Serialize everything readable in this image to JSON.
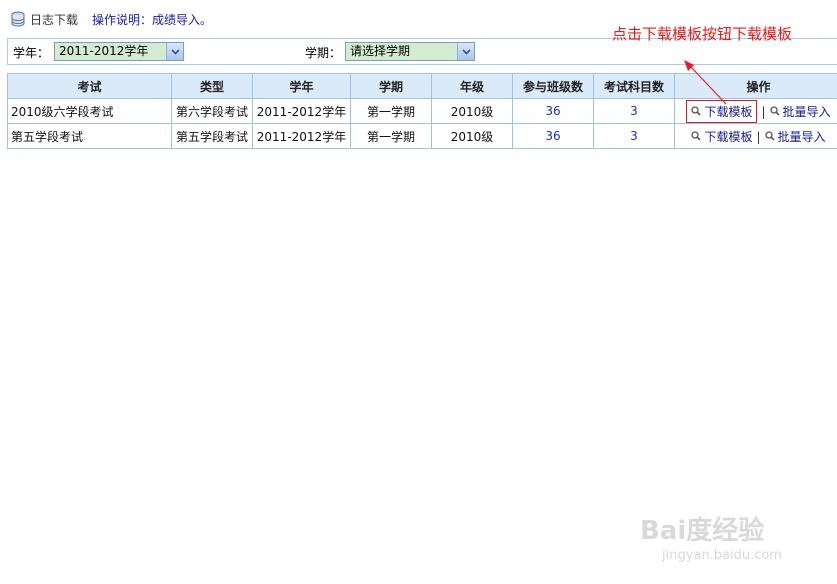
{
  "header": {
    "log_link": "日志下载",
    "instruction": "操作说明：成绩导入。"
  },
  "filters": {
    "year_label": "学年：",
    "year_value": "2011-2012学年",
    "term_label": "学期：",
    "term_value": "请选择学期"
  },
  "table": {
    "columns": [
      "考试",
      "类型",
      "学年",
      "学期",
      "年级",
      "参与班级数",
      "考试科目数",
      "操作"
    ],
    "rows": [
      {
        "exam": "2010级六学段考试",
        "type": "第六学段考试",
        "year": "2011-2012学年",
        "term": "第一学期",
        "grade": "2010级",
        "classes": "36",
        "subjects": "3",
        "download": "下载模板",
        "import": "批量导入"
      },
      {
        "exam": "第五学段考试",
        "type": "第五学段考试",
        "year": "2011-2012学年",
        "term": "第一学期",
        "grade": "2010级",
        "classes": "36",
        "subjects": "3",
        "download": "下载模板",
        "import": "批量导入"
      }
    ],
    "separator": "|"
  },
  "annotation": {
    "text": "点击下载模板按钮下载模板",
    "color": "#e02020"
  },
  "watermark": {
    "brand": "Bai度经验",
    "url": "jingyan.baidu.com"
  }
}
